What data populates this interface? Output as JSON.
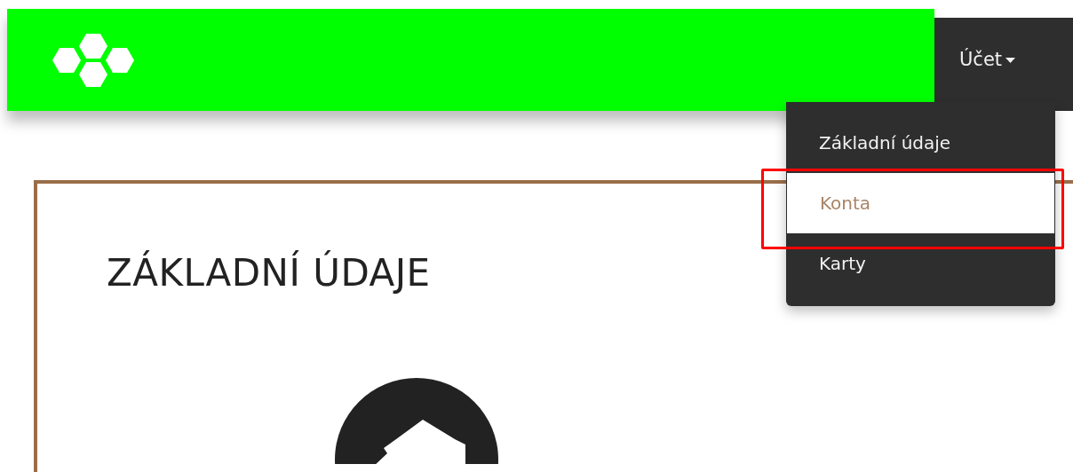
{
  "header": {
    "logo": {
      "kind": "hexagons"
    }
  },
  "account_menu": {
    "label": "Účet",
    "expanded": true,
    "items": [
      {
        "label": "Základní údaje",
        "selected": false,
        "highlighted": false
      },
      {
        "label": "Konta",
        "selected": true,
        "highlighted": true
      },
      {
        "label": "Karty",
        "selected": false,
        "highlighted": false
      }
    ]
  },
  "card": {
    "title": "ZÁKLADNÍ ÚDAJE",
    "avatar": {
      "kind": "silhouette"
    }
  }
}
